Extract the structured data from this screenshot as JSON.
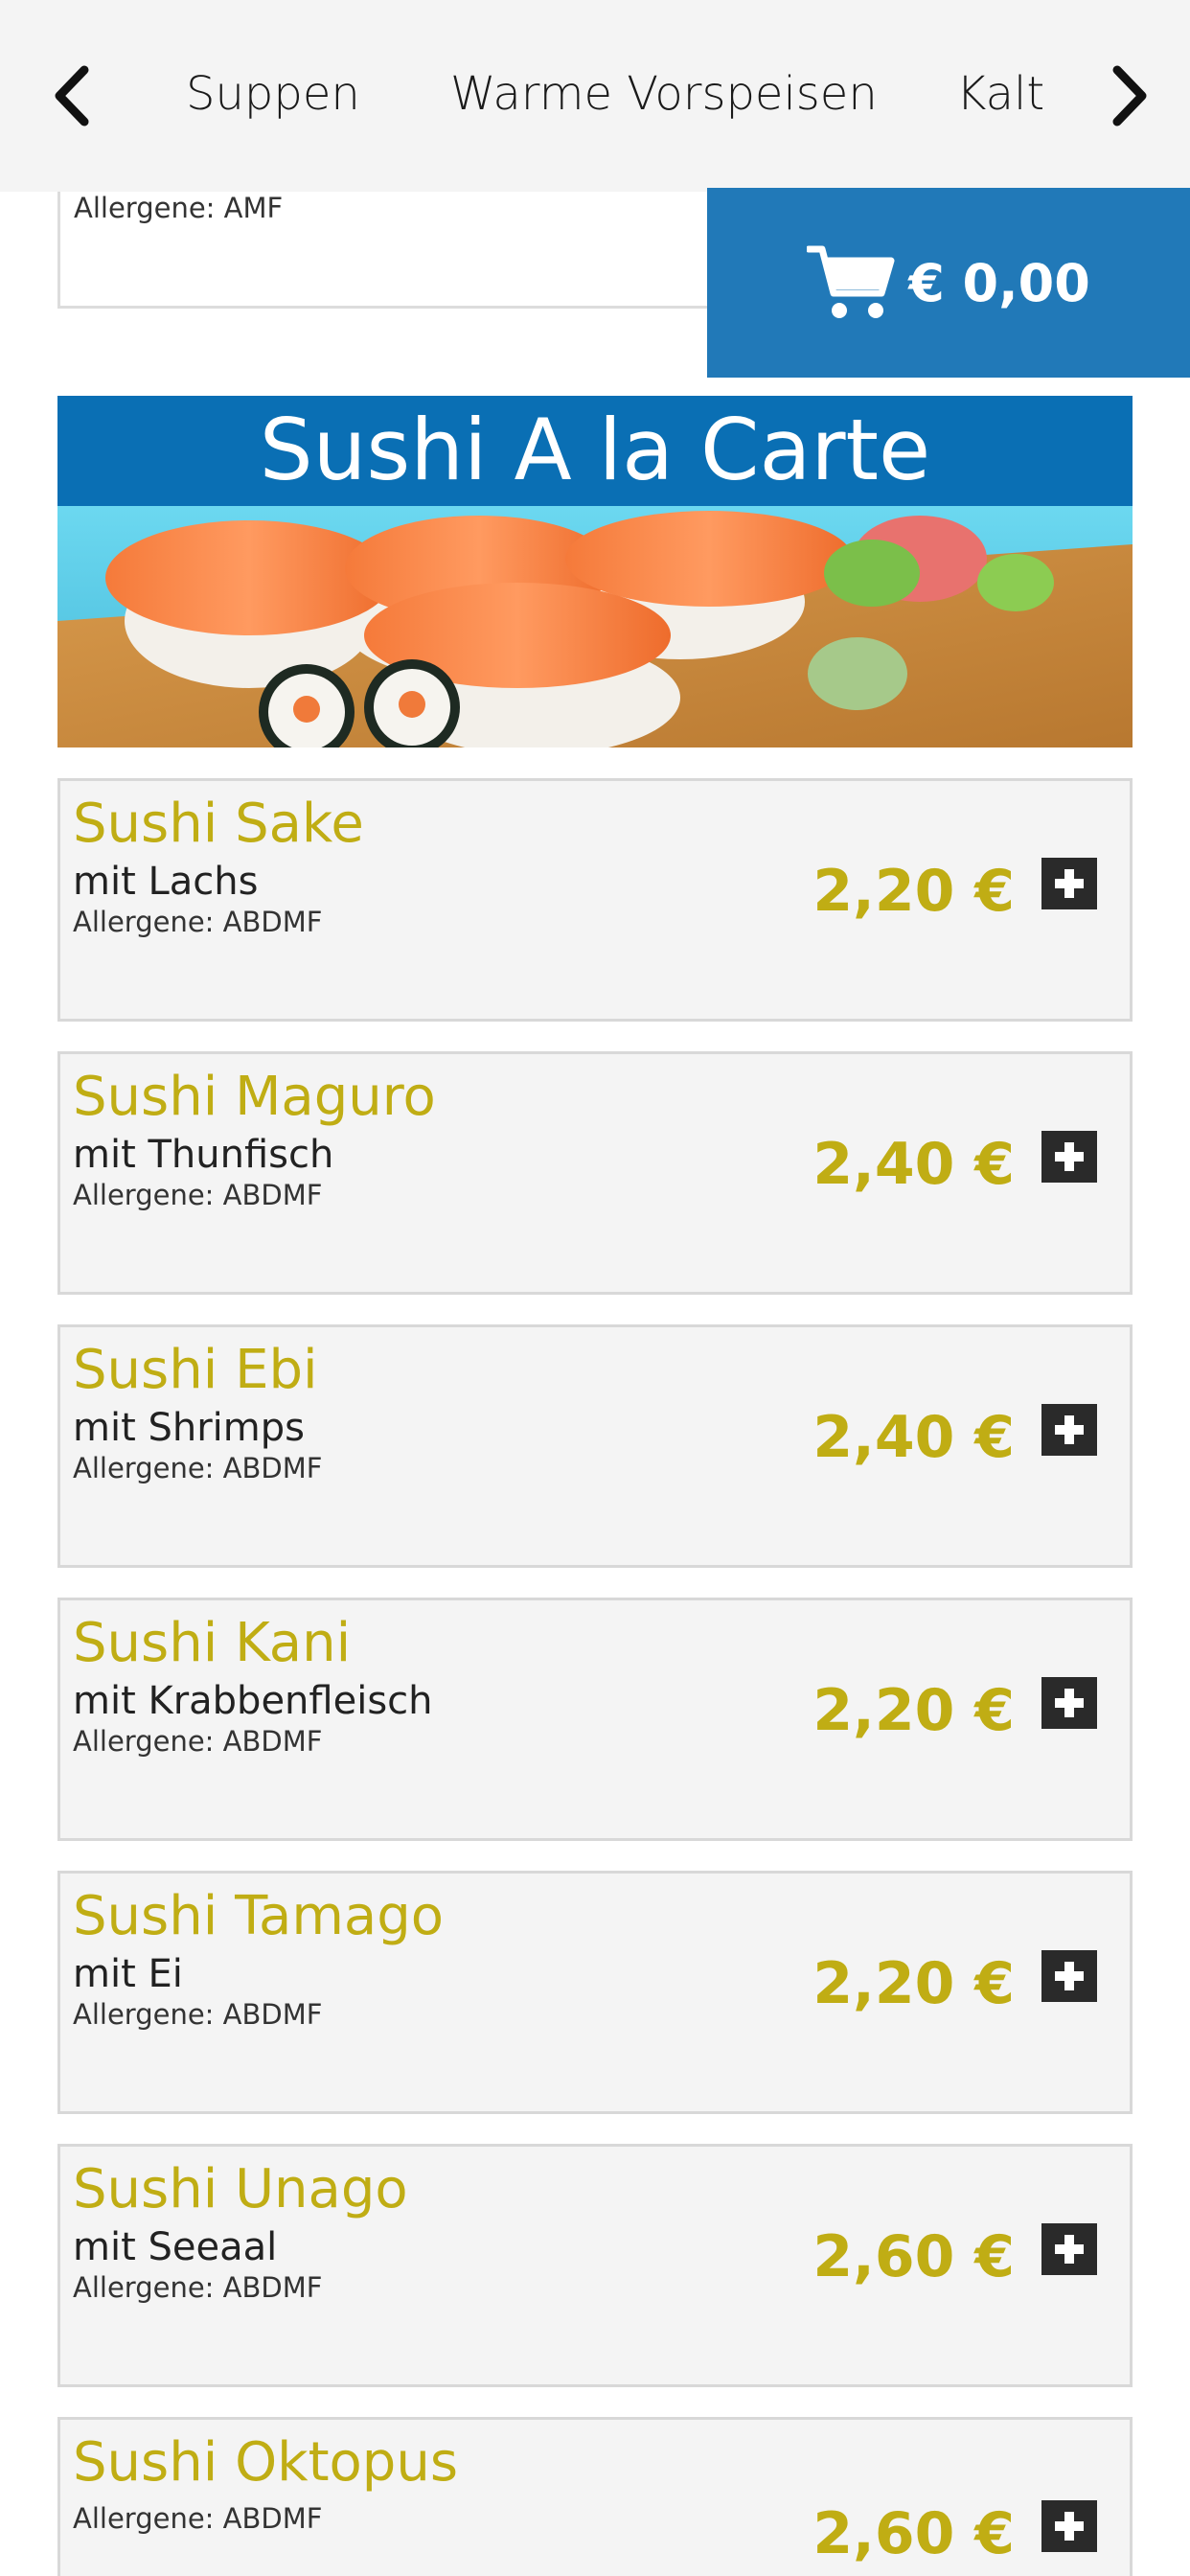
{
  "nav": {
    "tabs": [
      {
        "label": "Suppen"
      },
      {
        "label": "Warme Vorspeisen"
      },
      {
        "label": "Kalte Vorspeisen"
      }
    ],
    "prev_icon": "chevron-left-icon",
    "next_icon": "chevron-right-icon"
  },
  "previous_item": {
    "allergens": "Allergene: AMF"
  },
  "cart": {
    "icon": "cart-icon",
    "total": "€ 0,00"
  },
  "section": {
    "title": "Sushi A la Carte"
  },
  "items": [
    {
      "name": "Sushi Sake",
      "desc": "mit Lachs",
      "allergens": "Allergene: ABDMF",
      "price": "2,20 €"
    },
    {
      "name": "Sushi Maguro",
      "desc": "mit Thunfisch",
      "allergens": "Allergene: ABDMF",
      "price": "2,40 €"
    },
    {
      "name": "Sushi Ebi",
      "desc": "mit Shrimps",
      "allergens": "Allergene: ABDMF",
      "price": "2,40 €"
    },
    {
      "name": "Sushi Kani",
      "desc": "mit Krabbenfleisch",
      "allergens": "Allergene: ABDMF",
      "price": "2,20 €"
    },
    {
      "name": "Sushi Tamago",
      "desc": "mit Ei",
      "allergens": "Allergene: ABDMF",
      "price": "2,20 €"
    },
    {
      "name": "Sushi Unago",
      "desc": "mit Seeaal",
      "allergens": "Allergene: ABDMF",
      "price": "2,60 €"
    },
    {
      "name": "Sushi Oktopus",
      "desc": "",
      "allergens": "Allergene: ABDMF",
      "price": "2,60 €"
    }
  ],
  "colors": {
    "brand_blue": "#0a6fb4",
    "cart_blue": "#2179b8",
    "price_gold": "#c0ad14"
  }
}
